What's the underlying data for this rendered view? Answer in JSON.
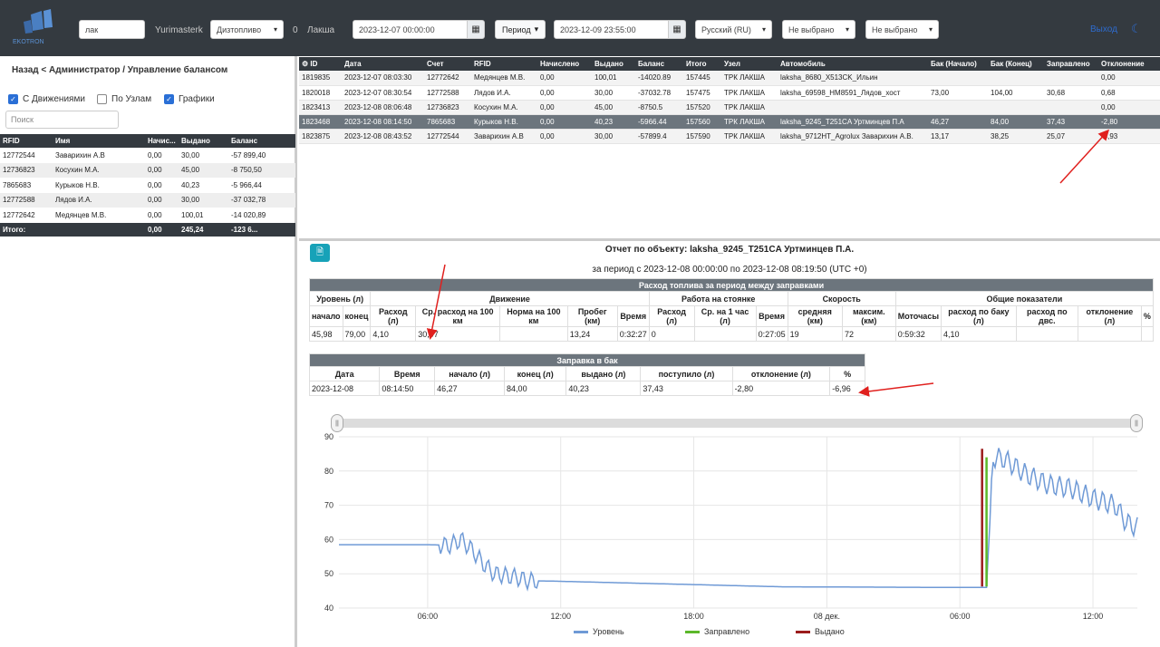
{
  "topbar": {
    "search_value": "лак",
    "user": "Yurimasterk",
    "fuel_select": "Дизтопливо",
    "count": "0",
    "location": "Лакша",
    "date_from": "2023-12-07 00:00:00",
    "period_label": "Период",
    "date_to": "2023-12-09 23:55:00",
    "language": "Русский (RU)",
    "filter1": "Не выбрано",
    "filter2": "Не выбрано",
    "logout": "Выход",
    "colors": {
      "bg": "#343a40",
      "link": "#2e6ccf"
    }
  },
  "left": {
    "breadcrumb": "Назад < Администратор / Управление балансом",
    "checkboxes": [
      {
        "label": "С Движениями",
        "checked": true
      },
      {
        "label": "По Узлам",
        "checked": false
      },
      {
        "label": "Графики",
        "checked": true
      }
    ],
    "search_placeholder": "Поиск",
    "headers": [
      "RFID",
      "Имя",
      "Начис...",
      "Выдано",
      "Баланс"
    ],
    "rows": [
      [
        "12772544",
        "Заварихин А.В",
        "0,00",
        "30,00",
        "-57 899,40"
      ],
      [
        "12736823",
        "Косухин М.А.",
        "0,00",
        "45,00",
        "-8 750,50"
      ],
      [
        "7865683",
        "Курыков Н.В.",
        "0,00",
        "40,23",
        "-5 966,44"
      ],
      [
        "12772588",
        "Лядов И.А.",
        "0,00",
        "30,00",
        "-37 032,78"
      ],
      [
        "12772642",
        "Медянцев М.В.",
        "0,00",
        "100,01",
        "-14 020,89"
      ]
    ],
    "footer": [
      "Итого:",
      "",
      "0,00",
      "245,24",
      "-123 6..."
    ]
  },
  "transactions": {
    "headers": [
      "ID",
      "Дата",
      "Счет",
      "RFID",
      "Начислено",
      "Выдано",
      "Баланс",
      "Итого",
      "Узел",
      "Автомобиль",
      "Бак (Начало)",
      "Бак (Конец)",
      "Заправлено",
      "Отклонение"
    ],
    "rows": [
      [
        "1819835",
        "2023-12-07 08:03:30",
        "12772642",
        "Медянцев М.В.",
        "0,00",
        "100,01",
        "-14020.89",
        "157445",
        "ТРК ЛАКША",
        "laksha_8680_X513CK_Ильин",
        "",
        "",
        "",
        "0,00"
      ],
      [
        "1820018",
        "2023-12-07 08:30:54",
        "12772588",
        "Лядов И.А.",
        "0,00",
        "30,00",
        "-37032.78",
        "157475",
        "ТРК ЛАКША",
        "laksha_69598_HM8591_Лядов_хост",
        "73,00",
        "104,00",
        "30,68",
        "0,68"
      ],
      [
        "1823413",
        "2023-12-08 08:06:48",
        "12736823",
        "Косухин М.А.",
        "0,00",
        "45,00",
        "-8750.5",
        "157520",
        "ТРК ЛАКША",
        "",
        "",
        "",
        "",
        "0,00"
      ],
      [
        "1823468",
        "2023-12-08 08:14:50",
        "7865683",
        "Курыков Н.В.",
        "0,00",
        "40,23",
        "-5966.44",
        "157560",
        "ТРК ЛАКША",
        "laksha_9245_T251CA Уртминцев П.А",
        "46,27",
        "84,00",
        "37,43",
        "-2,80"
      ],
      [
        "1823875",
        "2023-12-08 08:43:52",
        "12772544",
        "Заварихин А.В",
        "0,00",
        "30,00",
        "-57899.4",
        "157590",
        "ТРК ЛАКША",
        "laksha_9712HT_Agrolux Заварихин А.В.",
        "13,17",
        "38,25",
        "25,07",
        "-4,93"
      ]
    ]
  },
  "report": {
    "title": "Отчет по объекту: laksha_9245_T251CA Уртминцев П.А.",
    "subtitle": "за период с 2023-12-08 00:00:00 по 2023-12-08 08:19:50 (UTC +0)",
    "consumption": {
      "band": "Расход топлива за период между заправками",
      "groups": [
        "Уровень (л)",
        "Движение",
        "Работа на стоянке",
        "Скорость",
        "Общие показатели"
      ],
      "cols": [
        "начало",
        "конец",
        "Расход (л)",
        "Ср. расход на 100 км",
        "Норма на 100 км",
        "Пробег (км)",
        "Время",
        "Расход (л)",
        "Ср. на 1 час (л)",
        "Время",
        "средняя (км)",
        "максим. (км)",
        "Моточасы",
        "расход по баку (л)",
        "расход по двс.",
        "отклонение (л)",
        "%"
      ],
      "values": [
        "45,98",
        "79,00",
        "4,10",
        "30,97",
        "",
        "13,24",
        "0:32:27",
        "0",
        "",
        "0:27:05",
        "19",
        "72",
        "0:59:32",
        "4,10",
        "",
        "",
        ""
      ]
    },
    "refuel": {
      "band": "Заправка в бак",
      "cols": [
        "Дата",
        "Время",
        "начало (л)",
        "конец (л)",
        "выдано (л)",
        "поступило (л)",
        "отклонение (л)",
        "%"
      ],
      "values": [
        "2023-12-08",
        "08:14:50",
        "46,27",
        "84,00",
        "40,23",
        "37,43",
        "-2,80",
        "-6,96"
      ]
    }
  },
  "chart_data": {
    "type": "line",
    "y_ticks": [
      "90",
      "80",
      "70",
      "60",
      "50",
      "40"
    ],
    "x_ticks": [
      "06:00",
      "12:00",
      "18:00",
      "08 дек.",
      "06:00",
      "12:00"
    ],
    "ylim": [
      40,
      90
    ],
    "series": [
      {
        "name": "Уровень",
        "color": "#6f9ad6"
      },
      {
        "name": "Заправлено",
        "color": "#5cb82a"
      },
      {
        "name": "Выдано",
        "color": "#9b1c1c"
      }
    ],
    "level_points": [
      [
        0,
        58.5
      ],
      [
        4,
        58.5
      ],
      [
        5,
        58.3
      ],
      [
        5.5,
        60
      ],
      [
        6,
        57
      ],
      [
        6.5,
        53
      ],
      [
        7,
        50
      ],
      [
        8,
        49
      ],
      [
        8.5,
        48
      ],
      [
        10,
        47.8
      ],
      [
        20,
        46.2
      ],
      [
        28,
        46
      ],
      [
        29.2,
        46
      ],
      [
        29.5,
        84
      ],
      [
        30,
        83.5
      ],
      [
        31,
        79
      ],
      [
        32,
        76
      ],
      [
        33,
        75
      ],
      [
        34,
        72
      ],
      [
        35,
        70
      ],
      [
        35.5,
        65
      ],
      [
        36,
        63.5
      ]
    ],
    "refuel": {
      "x": 29.2,
      "from": 46.27,
      "to": 84.0
    },
    "issued": {
      "x": 29.0,
      "from": 46.27,
      "to": 86.5
    }
  }
}
